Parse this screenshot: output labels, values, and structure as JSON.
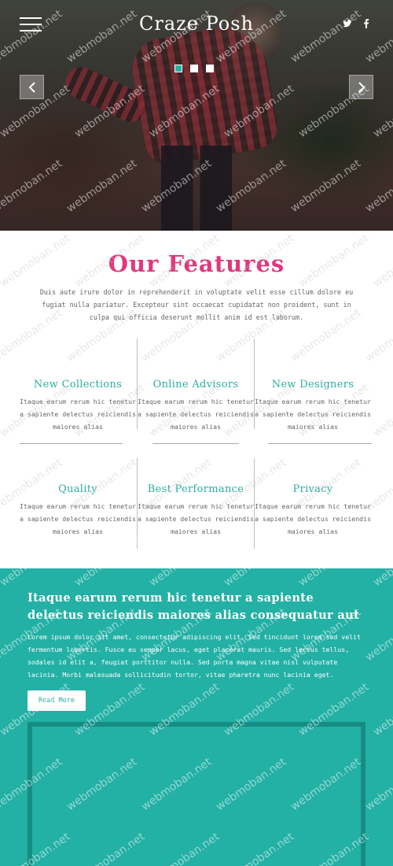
{
  "header": {
    "brand": "Craze Posh",
    "menu_icon": "hamburger-menu-icon",
    "social": [
      {
        "name": "twitter",
        "icon": "twitter-icon"
      },
      {
        "name": "facebook",
        "icon": "facebook-icon"
      }
    ]
  },
  "hero": {
    "slides": 3,
    "active_slide": 1,
    "prev_icon": "chevron-left-icon",
    "next_icon": "chevron-right-icon"
  },
  "features": {
    "title": "Our Features",
    "intro": "Duis aute irure dolor in reprehenderit in voluptate velit esse cillum dolore eu fugiat nulla pariatur. Excepteur sint occaecat cupidatat non proident, sunt in culpa qui officia deserunt mollit anim id est laborum.",
    "items": [
      {
        "title": "New Collections",
        "desc": "Itaque earum rerum hic tenetur a sapiente delectus reiciendis maiores alias"
      },
      {
        "title": "Online Advisors",
        "desc": "Itaque earum rerum hic tenetur a sapiente delectus reiciendis maiores alias"
      },
      {
        "title": "New Designers",
        "desc": "Itaque earum rerum hic tenetur a sapiente delectus reiciendis maiores alias"
      },
      {
        "title": "Quality",
        "desc": "Itaque earum rerum hic tenetur a sapiente delectus reiciendis maiores alias"
      },
      {
        "title": "Best Performance",
        "desc": "Itaque earum rerum hic tenetur a sapiente delectus reiciendis maiores alias"
      },
      {
        "title": "Privacy",
        "desc": "Itaque earum rerum hic tenetur a sapiente delectus reiciendis maiores alias"
      }
    ]
  },
  "about": {
    "heading": "Itaque earum rerum hic tenetur a sapiente delectus reiciendis maiores alias consequatur aut",
    "body": "Lorem ipsum dolor sit amet, consectetur adipiscing elit. Sed tincidunt lorem sed velit fermentum lobortis. Fusce eu semper lacus, eget placerat mauris. Sed lectus tellus, sodales id elit a, feugiat porttitor nulla. Sed porta magna vitae nisl vulputate lacinia. Morbi malesuada sollicitudin tortor, vitae pharetra nunc lacinia eget.",
    "button": "Read More"
  },
  "watermark": "webmoban.net",
  "colors": {
    "accent_teal": "#23b0a5",
    "feature_teal": "#2aaea3",
    "title_pink": "#e0387e",
    "frame_dark_teal": "#168c82"
  }
}
